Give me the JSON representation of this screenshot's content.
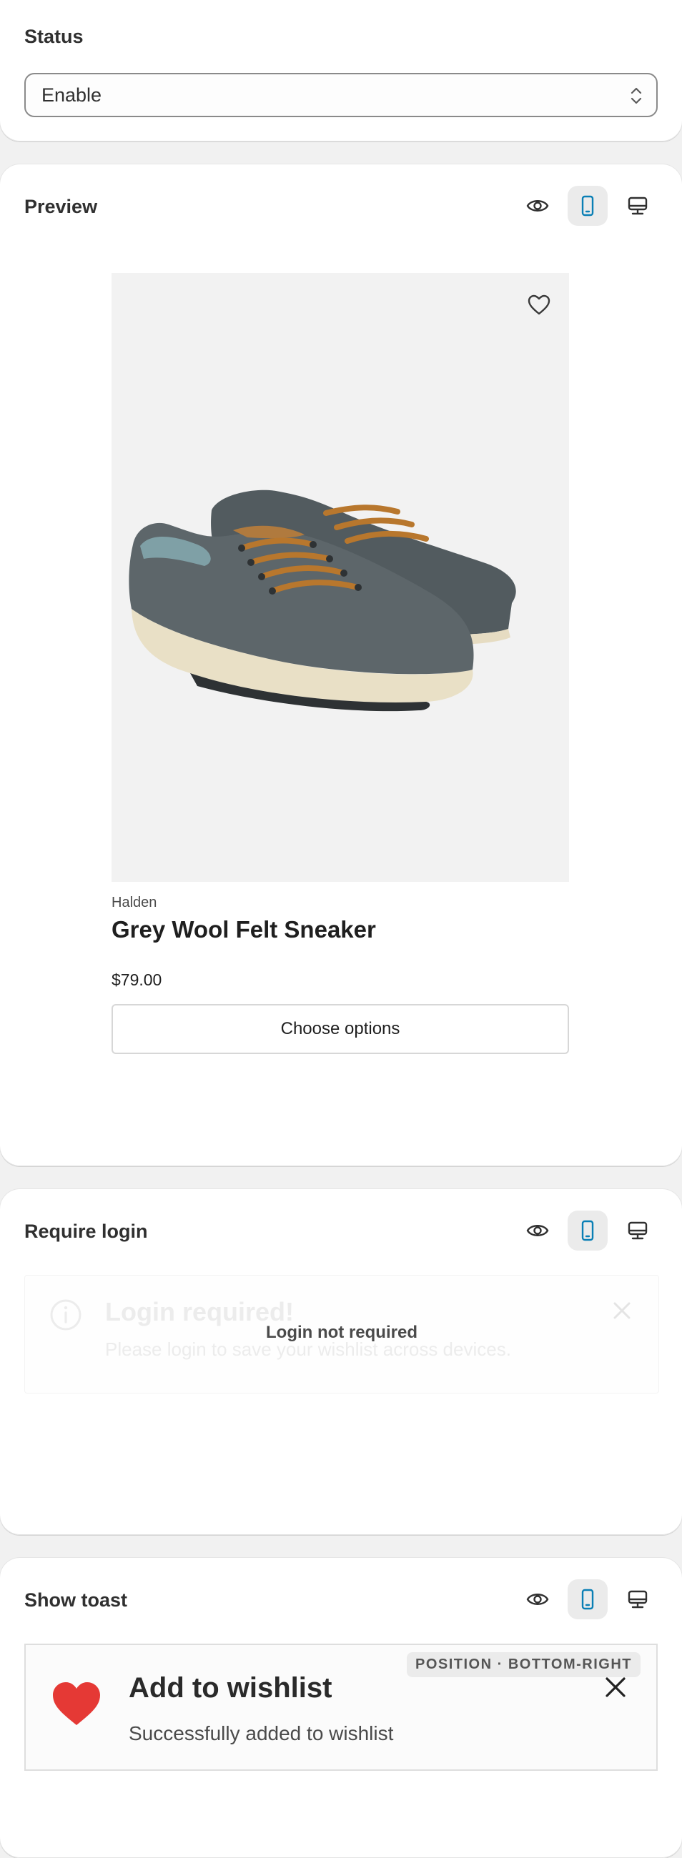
{
  "status": {
    "title": "Status",
    "select_value": "Enable",
    "icon": "select-chevrons-icon"
  },
  "preview": {
    "title": "Preview",
    "icons": [
      "eye-icon",
      "mobile-icon",
      "desktop-icon"
    ],
    "active_view": "mobile",
    "product": {
      "vendor": "Halden",
      "title": "Grey Wool Felt Sneaker",
      "price": "$79.00",
      "button_label": "Choose options",
      "wishlist_icon": "heart-outline-icon"
    }
  },
  "require_login": {
    "title": "Require login",
    "banner_title": "Login required!",
    "banner_text": "Please login to save your wishlist across devices.",
    "overlay_text": "Login not required"
  },
  "show_toast": {
    "title": "Show toast",
    "toast_title": "Add to wishlist",
    "toast_message": "Successfully added to wishlist",
    "position_badge": "POSITION · BOTTOM-RIGHT"
  },
  "colors": {
    "accent": "#0a7fb5",
    "heart": "#e53935"
  }
}
